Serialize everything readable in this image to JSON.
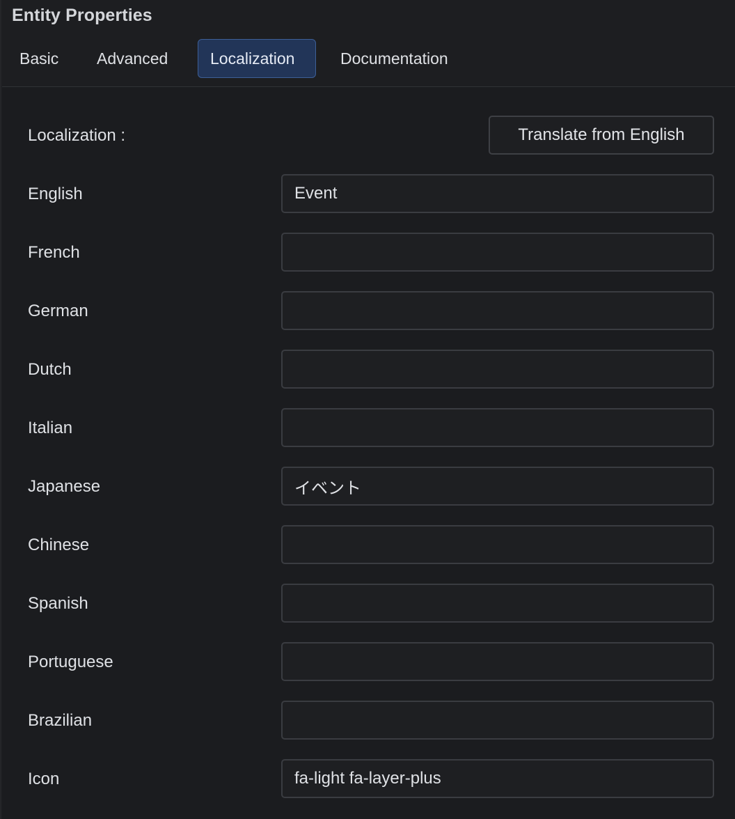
{
  "panel": {
    "title": "Entity Properties"
  },
  "tabs": [
    {
      "label": "Basic",
      "active": false
    },
    {
      "label": "Advanced",
      "active": false
    },
    {
      "label": "Localization",
      "active": true
    },
    {
      "label": "Documentation",
      "active": false
    }
  ],
  "localization": {
    "section_label": "Localization :",
    "translate_button": "Translate from English",
    "rows": [
      {
        "label": "English",
        "value": "Event"
      },
      {
        "label": "French",
        "value": ""
      },
      {
        "label": "German",
        "value": ""
      },
      {
        "label": "Dutch",
        "value": ""
      },
      {
        "label": "Italian",
        "value": ""
      },
      {
        "label": "Japanese",
        "value": "イベント"
      },
      {
        "label": "Chinese",
        "value": ""
      },
      {
        "label": "Spanish",
        "value": ""
      },
      {
        "label": "Portuguese",
        "value": ""
      },
      {
        "label": "Brazilian",
        "value": ""
      },
      {
        "label": "Icon",
        "value": "fa-light fa-layer-plus"
      }
    ]
  },
  "colors": {
    "background": "#1d1e21",
    "active_tab_bg": "#223558",
    "active_tab_border": "#3d5f97",
    "field_border": "#3a3c41",
    "text": "#dfe1e5"
  }
}
